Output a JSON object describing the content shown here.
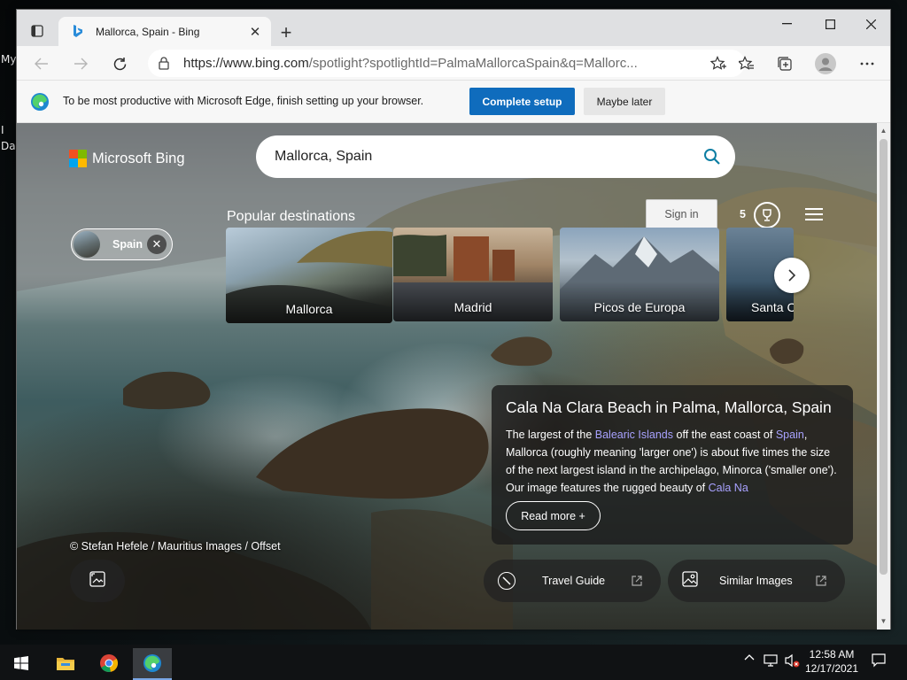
{
  "desktop": {
    "label_1": "My",
    "label_2": "I",
    "label_3": "Da"
  },
  "tab": {
    "title": "Mallorca, Spain - Bing"
  },
  "address_bar": {
    "url_host": "https://www.bing.com",
    "url_path": "/spotlight?spotlightId=PalmaMallorcaSpain&q=Mallorc..."
  },
  "infobar": {
    "message": "To be most productive with Microsoft Edge, finish setting up your browser.",
    "primary_button": "Complete setup",
    "secondary_button": "Maybe later"
  },
  "bing": {
    "brand": "Microsoft Bing",
    "search_value": "Mallorca, Spain",
    "sign_in": "Sign in",
    "rewards_points": "5",
    "chip_label": "Spain",
    "popular_title": "Popular destinations",
    "destinations": [
      {
        "name": "Mallorca"
      },
      {
        "name": "Madrid"
      },
      {
        "name": "Picos de Europa"
      },
      {
        "name": "Santa C"
      }
    ],
    "info_title": "Cala Na Clara Beach in Palma, Mallorca, Spain",
    "info_body": {
      "p1": "The largest of the ",
      "link1": "Balearic Islands",
      "p2": " off the east coast of ",
      "link2": "Spain",
      "p3": ", Mallorca (roughly meaning 'larger one') is about five times the size of the next largest island in the archipelago, Minorca ('smaller one'). Our image features the rugged beauty of ",
      "link3": "Cala Na"
    },
    "read_more": "Read more +",
    "credit": "© Stefan Hefele / Mauritius Images / Offset",
    "travel_guide": "Travel Guide",
    "similar_images": "Similar Images"
  },
  "taskbar": {
    "time": "12:58 AM",
    "date": "12/17/2021"
  },
  "colors": {
    "accent": "#0f6cbd",
    "link": "#a8a2ff",
    "ms_red": "#f25022",
    "ms_green": "#7fba00",
    "ms_blue": "#00a4ef",
    "ms_yellow": "#ffb900"
  }
}
